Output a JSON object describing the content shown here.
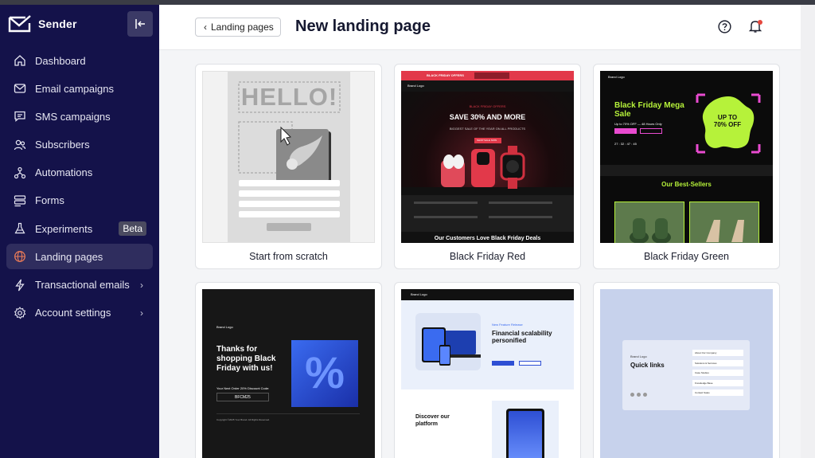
{
  "app": {
    "name": "Sender"
  },
  "sidebar": {
    "items": [
      {
        "label": "Dashboard",
        "icon": "home-icon"
      },
      {
        "label": "Email campaigns",
        "icon": "envelope-icon"
      },
      {
        "label": "SMS campaigns",
        "icon": "chat-icon"
      },
      {
        "label": "Subscribers",
        "icon": "users-icon"
      },
      {
        "label": "Automations",
        "icon": "flow-icon"
      },
      {
        "label": "Forms",
        "icon": "forms-icon"
      },
      {
        "label": "Experiments",
        "icon": "flask-icon",
        "badge": "Beta"
      },
      {
        "label": "Landing pages",
        "icon": "globe-icon",
        "active": true
      },
      {
        "label": "Transactional emails",
        "icon": "bolt-icon",
        "chevron": "›"
      },
      {
        "label": "Account settings",
        "icon": "gear-icon",
        "chevron": "›"
      }
    ]
  },
  "header": {
    "back_label": "Landing pages",
    "title": "New landing page"
  },
  "templates": [
    {
      "label": "Start from scratch",
      "thumb": {
        "hello": "HELLO!"
      }
    },
    {
      "label": "Black Friday Red",
      "thumb": {
        "topbar": "BLACK FRIDAY OFFERS",
        "logo": "Brand Logo",
        "kicker": "BLACK FRIDAY OFFERS",
        "headline": "SAVE 30% AND MORE",
        "sub": "BIGGEST SALE OF THE YEAR ON ALL PRODUCTS",
        "cta": "SHOP SALE NOW",
        "footer": "Our Customers Love Black Friday Deals"
      }
    },
    {
      "label": "Black Friday Green",
      "thumb": {
        "logo": "Brand Logo",
        "headline": "Black Friday Mega Sale",
        "sub": "Up to 70% OFF — 48 Hours Only",
        "badge": "UP TO 70% OFF",
        "timer": "27 : 32 : 47 : 45",
        "bestsellers": "Our Best-Sellers"
      }
    },
    {
      "label": "",
      "thumb": {
        "logo": "Brand Logo",
        "headline": "Thanks for shopping Black Friday with us!",
        "code_label": "Your Next Order 20% Discount Code:",
        "code": "BFCM25",
        "copyright": "Copyright ©2025 Your Brand. All Rights Reserved."
      }
    },
    {
      "label": "",
      "thumb": {
        "logo": "Brand Logo",
        "kicker": "New Feature Release",
        "headline": "Financial scalability personified",
        "section": "Discover our platform"
      }
    },
    {
      "label": "",
      "thumb": {
        "logo": "Brand Logo",
        "headline": "Quick links",
        "links": [
          "About Our Company",
          "Solutions & Services",
          "Case Studies",
          "Knowledge Base",
          "Contact Sales"
        ]
      }
    }
  ],
  "colors": {
    "sidebar_bg": "#14124a",
    "active_bg": "#2f2d5e",
    "accent_red": "#e5483e",
    "bf_red": "#e2394a",
    "bf_green": "#b6f23a",
    "bf_pink": "#e94bd0"
  }
}
